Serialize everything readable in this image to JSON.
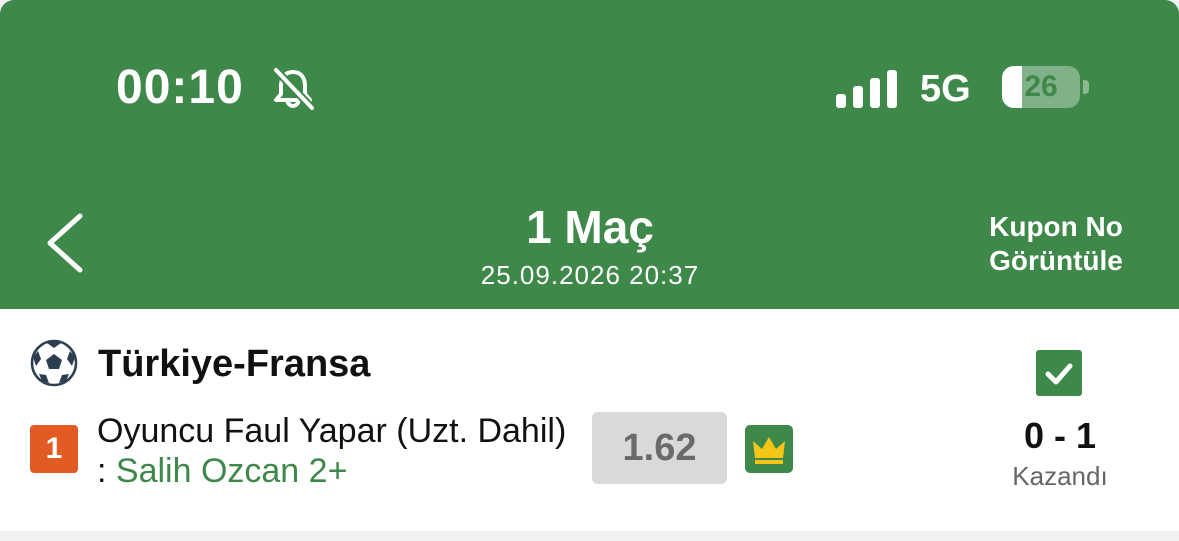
{
  "status_bar": {
    "time": "00:10",
    "network": "5G",
    "battery": "26",
    "battery_fraction": 0.26,
    "icons": [
      "bell-slash-icon",
      "signal-icon",
      "battery-icon"
    ]
  },
  "header": {
    "title": "1 Maç",
    "subtitle": "25.09.2026 20:37",
    "kupon_line1": "Kupon No",
    "kupon_line2": "Görüntüle",
    "background": "#3e884a"
  },
  "bet": {
    "match": "Türkiye-Fransa",
    "number": "1",
    "market": "Oyuncu Faul Yapar (Uzt. Dahil) :",
    "selection": "Salih Ozcan 2+",
    "odds": "1.62",
    "score": "0 - 1",
    "status": "Kazandı",
    "icons": [
      "soccer-ball-icon",
      "checkbox-checked-icon",
      "crown-icon"
    ],
    "accent": "#3e884a",
    "number_color": "#e25a24"
  }
}
